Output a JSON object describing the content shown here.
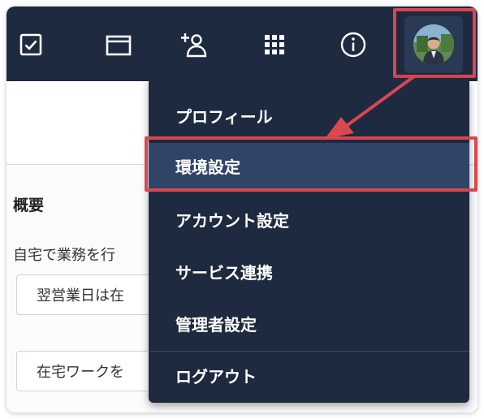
{
  "topbar": {
    "icons": [
      "checkbox-icon",
      "folder-icon",
      "add-user-icon",
      "apps-grid-icon",
      "info-icon"
    ],
    "accent_color": "#d9474f"
  },
  "background": {
    "overview_title": "概要",
    "description": "自宅で業務を行",
    "field1_value": "翌営業日は在",
    "field2_value": "在宅ワークを"
  },
  "menu": {
    "items": [
      {
        "label": "プロフィール"
      },
      {
        "label": "環境設定"
      },
      {
        "label": "アカウント設定"
      },
      {
        "label": "サービス連携"
      },
      {
        "label": "管理者設定"
      },
      {
        "label": "ログアウト"
      }
    ]
  }
}
